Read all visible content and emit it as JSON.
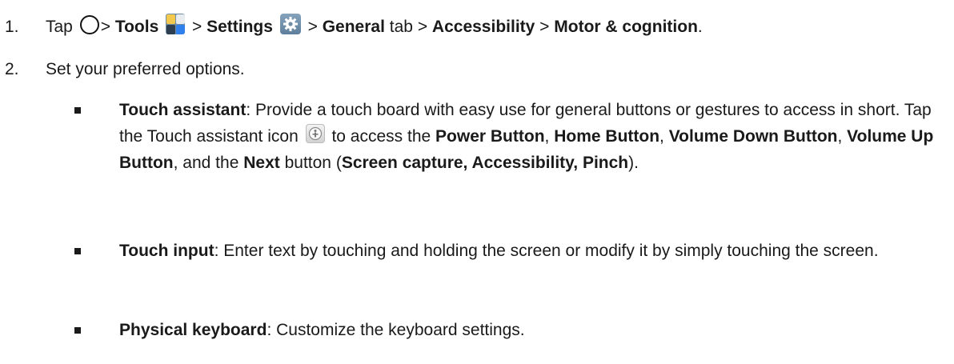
{
  "steps": [
    {
      "number": "1.",
      "parts": {
        "tap": "Tap",
        "sep": ">",
        "tools": "Tools",
        "settings": "Settings",
        "general": "General",
        "tab": "tab",
        "accessibility": "Accessibility",
        "motor": "Motor & cognition",
        "end": "."
      }
    },
    {
      "number": "2.",
      "text": "Set your preferred options."
    }
  ],
  "bullets": {
    "touch_assistant": {
      "title": "Touch assistant",
      "desc1": ": Provide a touch board with easy use for general buttons or gestures to access in short. Tap the Touch assistant icon",
      "desc2": "to access the",
      "power": "Power Button",
      "comma1": ",",
      "home": "Home Button",
      "comma2": ",",
      "voldown": "Volume Down Button",
      "comma3": ",",
      "volup": "Volume Up Button",
      "and_the": ", and the",
      "next": "Next",
      "button_open": "button (",
      "list": "Screen capture, Accessibility, Pinch",
      "close": ")."
    },
    "touch_input": {
      "title": "Touch input",
      "desc": ": Enter text by touching and holding the screen or modify it by simply touching the screen."
    },
    "physical_keyboard": {
      "title": "Physical keyboard",
      "desc": ": Customize the keyboard settings."
    }
  },
  "icons": {
    "home": "home-circle-icon",
    "tools": "tools-folder-icon",
    "settings": "settings-gear-icon",
    "touch_assistant": "touch-assistant-icon"
  }
}
